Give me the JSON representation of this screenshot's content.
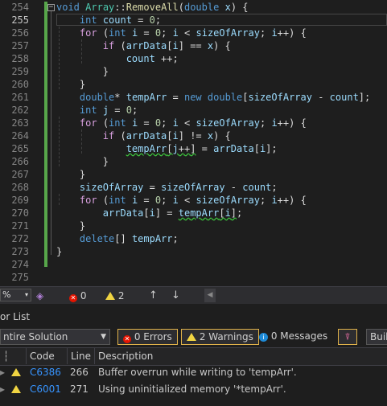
{
  "editor": {
    "line_numbers": [
      "254",
      "255",
      "256",
      "257",
      "258",
      "259",
      "260",
      "261",
      "262",
      "263",
      "264",
      "265",
      "266",
      "267",
      "268",
      "269",
      "270",
      "271",
      "272",
      "273",
      "274",
      "275"
    ],
    "lines": [
      [
        {
          "t": "void",
          "c": "kw"
        },
        {
          "t": " "
        },
        {
          "t": "Array",
          "c": "ty"
        },
        {
          "t": "::"
        },
        {
          "t": "RemoveAll",
          "c": "fn"
        },
        {
          "t": "("
        },
        {
          "t": "double",
          "c": "kw"
        },
        {
          "t": " "
        },
        {
          "t": "x",
          "c": "var"
        },
        {
          "t": ") {"
        }
      ],
      [
        {
          "t": "    "
        },
        {
          "t": "int",
          "c": "kw"
        },
        {
          "t": " "
        },
        {
          "t": "count",
          "c": "var"
        },
        {
          "t": " = "
        },
        {
          "t": "0",
          "c": "num"
        },
        {
          "t": ";"
        }
      ],
      [
        {
          "t": "    "
        },
        {
          "t": "for",
          "c": "ctl"
        },
        {
          "t": " ("
        },
        {
          "t": "int",
          "c": "kw"
        },
        {
          "t": " "
        },
        {
          "t": "i",
          "c": "var"
        },
        {
          "t": " = "
        },
        {
          "t": "0",
          "c": "num"
        },
        {
          "t": "; "
        },
        {
          "t": "i",
          "c": "var"
        },
        {
          "t": " < "
        },
        {
          "t": "sizeOfArray",
          "c": "var"
        },
        {
          "t": "; "
        },
        {
          "t": "i",
          "c": "var"
        },
        {
          "t": "++) {"
        }
      ],
      [
        {
          "t": "        "
        },
        {
          "t": "if",
          "c": "ctl"
        },
        {
          "t": " ("
        },
        {
          "t": "arrData",
          "c": "var"
        },
        {
          "t": "["
        },
        {
          "t": "i",
          "c": "var"
        },
        {
          "t": "] == "
        },
        {
          "t": "x",
          "c": "var"
        },
        {
          "t": ") {"
        }
      ],
      [
        {
          "t": "            "
        },
        {
          "t": "count",
          "c": "var"
        },
        {
          "t": " ++;"
        }
      ],
      [
        {
          "t": "        }"
        }
      ],
      [
        {
          "t": "    }"
        }
      ],
      [
        {
          "t": "    "
        },
        {
          "t": "double",
          "c": "kw"
        },
        {
          "t": "* "
        },
        {
          "t": "tempArr",
          "c": "var"
        },
        {
          "t": " = "
        },
        {
          "t": "new",
          "c": "kw"
        },
        {
          "t": " "
        },
        {
          "t": "double",
          "c": "kw"
        },
        {
          "t": "["
        },
        {
          "t": "sizeOfArray",
          "c": "var"
        },
        {
          "t": " - "
        },
        {
          "t": "count",
          "c": "var"
        },
        {
          "t": "];"
        }
      ],
      [
        {
          "t": "    "
        },
        {
          "t": "int",
          "c": "kw"
        },
        {
          "t": " "
        },
        {
          "t": "j",
          "c": "var"
        },
        {
          "t": " = "
        },
        {
          "t": "0",
          "c": "num"
        },
        {
          "t": ";"
        }
      ],
      [
        {
          "t": "    "
        },
        {
          "t": "for",
          "c": "ctl"
        },
        {
          "t": " ("
        },
        {
          "t": "int",
          "c": "kw"
        },
        {
          "t": " "
        },
        {
          "t": "i",
          "c": "var"
        },
        {
          "t": " = "
        },
        {
          "t": "0",
          "c": "num"
        },
        {
          "t": "; "
        },
        {
          "t": "i",
          "c": "var"
        },
        {
          "t": " < "
        },
        {
          "t": "sizeOfArray",
          "c": "var"
        },
        {
          "t": "; "
        },
        {
          "t": "i",
          "c": "var"
        },
        {
          "t": "++) {"
        }
      ],
      [
        {
          "t": "        "
        },
        {
          "t": "if",
          "c": "ctl"
        },
        {
          "t": " ("
        },
        {
          "t": "arrData",
          "c": "var"
        },
        {
          "t": "["
        },
        {
          "t": "i",
          "c": "var"
        },
        {
          "t": "] != "
        },
        {
          "t": "x",
          "c": "var"
        },
        {
          "t": ") {"
        }
      ],
      [
        {
          "t": "            "
        },
        {
          "t": "tempArr",
          "c": "var",
          "s": true
        },
        {
          "t": "[",
          "s": true
        },
        {
          "t": "j",
          "c": "var",
          "s": true
        },
        {
          "t": "++]",
          "s": true
        },
        {
          "t": " = "
        },
        {
          "t": "arrData",
          "c": "var"
        },
        {
          "t": "["
        },
        {
          "t": "i",
          "c": "var"
        },
        {
          "t": "];"
        }
      ],
      [
        {
          "t": "        }"
        }
      ],
      [
        {
          "t": "    }"
        }
      ],
      [
        {
          "t": "    "
        },
        {
          "t": "sizeOfArray",
          "c": "var"
        },
        {
          "t": " = "
        },
        {
          "t": "sizeOfArray",
          "c": "var"
        },
        {
          "t": " - "
        },
        {
          "t": "count",
          "c": "var"
        },
        {
          "t": ";"
        }
      ],
      [
        {
          "t": "    "
        },
        {
          "t": "for",
          "c": "ctl"
        },
        {
          "t": " ("
        },
        {
          "t": "int",
          "c": "kw"
        },
        {
          "t": " "
        },
        {
          "t": "i",
          "c": "var"
        },
        {
          "t": " = "
        },
        {
          "t": "0",
          "c": "num"
        },
        {
          "t": "; "
        },
        {
          "t": "i",
          "c": "var"
        },
        {
          "t": " < "
        },
        {
          "t": "sizeOfArray",
          "c": "var"
        },
        {
          "t": "; "
        },
        {
          "t": "i",
          "c": "var"
        },
        {
          "t": "++) {"
        }
      ],
      [
        {
          "t": "        "
        },
        {
          "t": "arrData",
          "c": "var"
        },
        {
          "t": "["
        },
        {
          "t": "i",
          "c": "var"
        },
        {
          "t": "] = "
        },
        {
          "t": "tempArr",
          "c": "var",
          "s": true
        },
        {
          "t": "[",
          "s": true
        },
        {
          "t": "i",
          "c": "var",
          "s": true
        },
        {
          "t": "]",
          "s": true
        },
        {
          "t": ";"
        }
      ],
      [
        {
          "t": "    }"
        }
      ],
      [
        {
          "t": "    "
        },
        {
          "t": "delete",
          "c": "kw"
        },
        {
          "t": "[] "
        },
        {
          "t": "tempArr",
          "c": "var"
        },
        {
          "t": ";"
        }
      ],
      [
        {
          "t": "}"
        }
      ],
      [
        {
          "t": ""
        }
      ],
      [
        {
          "t": ""
        }
      ]
    ],
    "current_line_index": 1
  },
  "status": {
    "zoom": "%",
    "errors_count": "0",
    "warnings_count": "2"
  },
  "error_list": {
    "title": "or List",
    "scope": "ntire Solution",
    "errors_btn": "0 Errors",
    "warnings_btn": "2 Warnings",
    "messages_btn": "0 Messages",
    "build_btn": "Buil",
    "columns": {
      "code": "Code",
      "line": "Line",
      "description": "Description"
    },
    "rows": [
      {
        "code": "C6386",
        "line": "266",
        "description": "Buffer overrun while writing to 'tempArr'."
      },
      {
        "code": "C6001",
        "line": "271",
        "description": "Using uninitialized memory '*tempArr'."
      }
    ]
  },
  "colors": {
    "accent": "#3794ff",
    "warning": "#f0d442",
    "error": "#e51400",
    "modified_bar": "#57a64a"
  }
}
